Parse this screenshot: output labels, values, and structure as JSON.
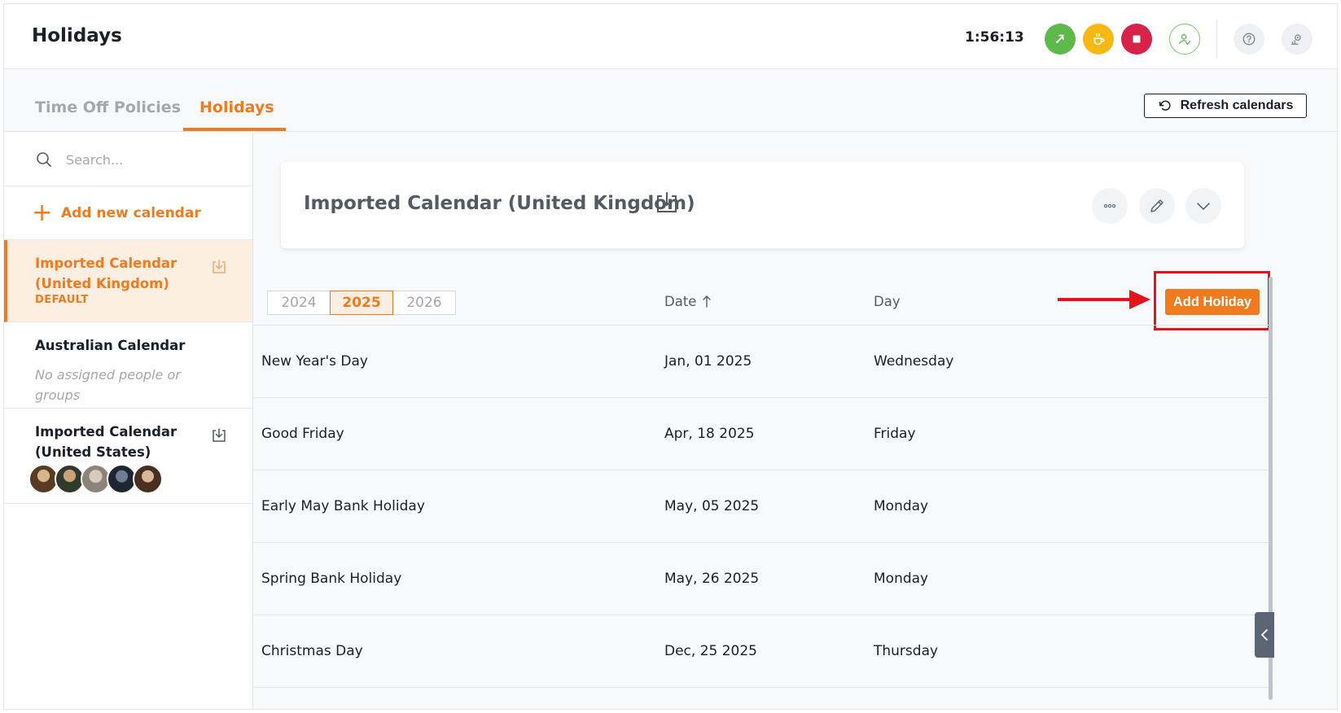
{
  "header": {
    "title": "Holidays",
    "timer": "1:56:13",
    "icons": [
      "clock-in-icon",
      "break-icon",
      "stop-icon",
      "user-status-icon",
      "help-icon",
      "settings-icon"
    ],
    "colors": {
      "green": "#5cb94a",
      "yellow": "#f6b913",
      "red": "#d7234a",
      "accent": "#f07b1f"
    }
  },
  "tabs": [
    {
      "label": "Time Off Policies",
      "active": false
    },
    {
      "label": "Holidays",
      "active": true
    }
  ],
  "refresh_label": "Refresh calendars",
  "sidebar": {
    "search_placeholder": "Search...",
    "add_calendar_label": "Add new calendar",
    "calendars": [
      {
        "name": "Imported Calendar (United Kingdom)",
        "badge": "DEFAULT",
        "imported": true,
        "active": true
      },
      {
        "name": "Australian Calendar",
        "note": "No assigned people or groups",
        "imported": false,
        "active": false
      },
      {
        "name": "Imported Calendar (United States)",
        "imported": true,
        "active": false,
        "avatar_count": 5
      }
    ]
  },
  "main": {
    "calendar_title": "Imported Calendar (United Kingdom)",
    "years": [
      "2024",
      "2025",
      "2026"
    ],
    "selected_year": "2025",
    "columns": {
      "date": "Date",
      "day": "Day"
    },
    "add_holiday_label": "Add Holiday",
    "holidays": [
      {
        "name": "New Year's Day",
        "date": "Jan, 01 2025",
        "day": "Wednesday"
      },
      {
        "name": "Good Friday",
        "date": "Apr, 18 2025",
        "day": "Friday"
      },
      {
        "name": "Early May Bank Holiday",
        "date": "May, 05 2025",
        "day": "Monday"
      },
      {
        "name": "Spring Bank Holiday",
        "date": "May, 26 2025",
        "day": "Monday"
      },
      {
        "name": "Christmas Day",
        "date": "Dec, 25 2025",
        "day": "Thursday"
      }
    ]
  }
}
